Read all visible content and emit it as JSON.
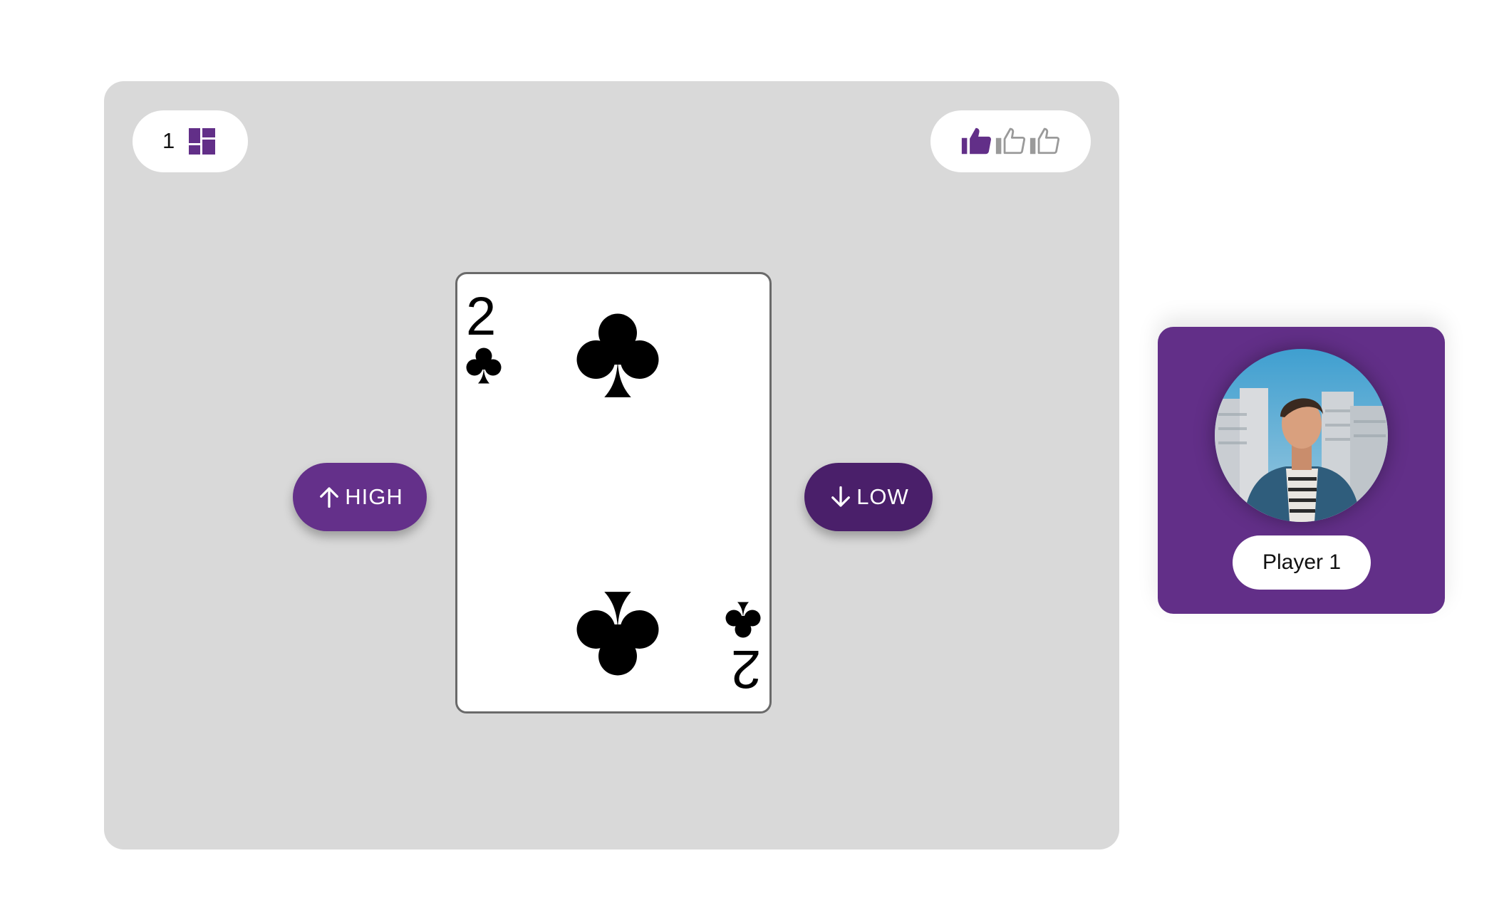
{
  "deck": {
    "count": "1",
    "icon": "deck-grid-icon"
  },
  "lives": {
    "total": 3,
    "remaining": 1,
    "icon": "thumbs-up-icon",
    "active_color": "#622f88",
    "inactive_color": "#9a9a9a"
  },
  "card": {
    "rank": "2",
    "suit": "clubs"
  },
  "buttons": {
    "high_label": "HIGH",
    "low_label": "LOW",
    "high_icon": "arrow-up-icon",
    "low_icon": "arrow-down-icon"
  },
  "player": {
    "name": "Player 1"
  },
  "colors": {
    "primary": "#622f88",
    "primary_dark": "#4a1f6a",
    "board": "#d9d9d9"
  }
}
